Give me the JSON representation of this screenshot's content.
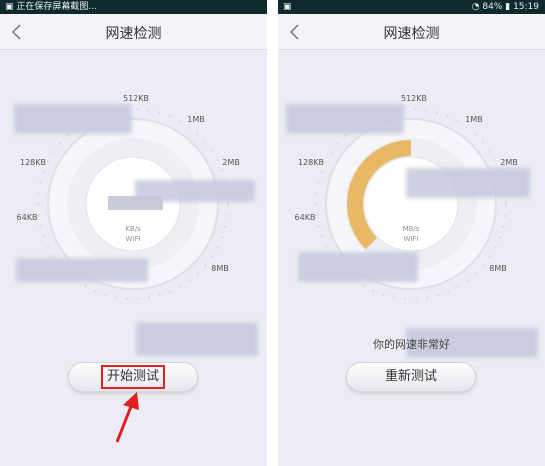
{
  "left": {
    "status_text": "正在保存屏幕截图...",
    "title": "网速检测",
    "scale_labels": [
      "512KB",
      "1MB",
      "2MB",
      "128KB",
      "64KB",
      "8MB"
    ],
    "unit": "KB/s",
    "network": "WIFI",
    "start_button": "开始测试"
  },
  "right": {
    "status_battery": "84%",
    "status_time": "15:19",
    "title": "网速检测",
    "scale_labels": [
      "512KB",
      "1MB",
      "2MB",
      "128KB",
      "64KB",
      "8MB"
    ],
    "unit": "MB/s",
    "network": "WIFI",
    "progress_fraction": 0.5,
    "result_text": "你的网速非常好",
    "retest_button": "重新测试"
  },
  "colors": {
    "progress": "#e8b867",
    "highlight": "#e0201f"
  }
}
